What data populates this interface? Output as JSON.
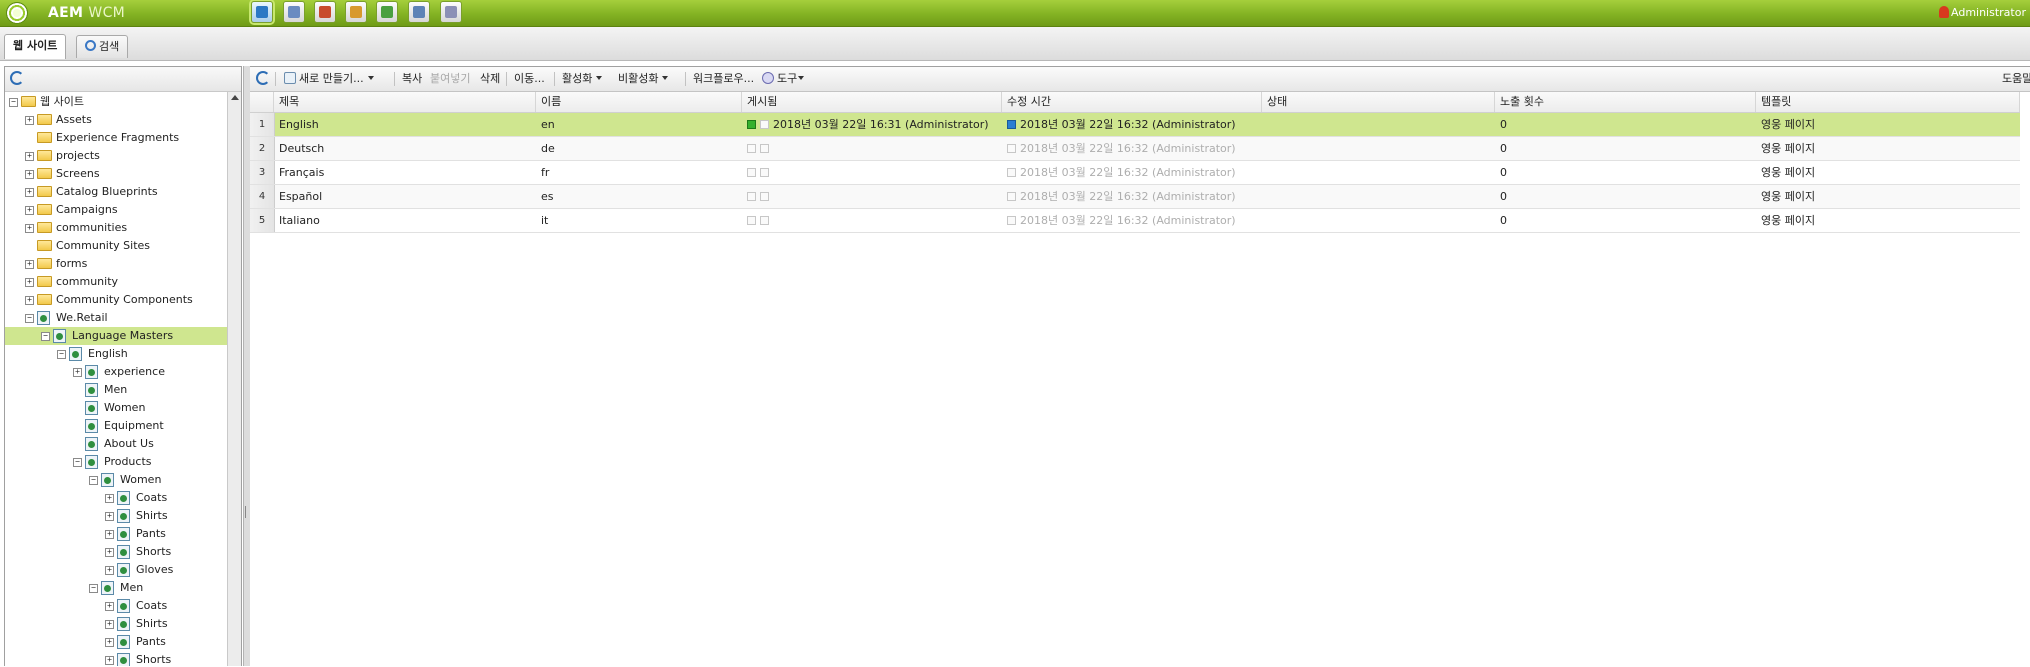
{
  "topbar": {
    "app_name": "AEM",
    "app_name_sub": "WCM",
    "user": "Administrator",
    "icons": [
      {
        "name": "websites-icon",
        "color": "#2b78c4",
        "active": true
      },
      {
        "name": "digital-assets-icon",
        "color": "#6b8cc1"
      },
      {
        "name": "tools-icon",
        "color": "#c84b2c"
      },
      {
        "name": "inbox-icon",
        "color": "#d8992e"
      },
      {
        "name": "users-icon",
        "color": "#4aa040"
      },
      {
        "name": "tagging-icon",
        "color": "#5d83b6"
      },
      {
        "name": "workflow-icon",
        "color": "#8b8fb6"
      }
    ]
  },
  "tabs": [
    {
      "label": "웹 사이트"
    },
    {
      "label": "검색"
    }
  ],
  "tree": {
    "items": [
      {
        "label": "웹 사이트",
        "level": 0,
        "expand": "-",
        "icon": "folder"
      },
      {
        "label": "Assets",
        "level": 1,
        "expand": "+",
        "icon": "folder"
      },
      {
        "label": "Experience Fragments",
        "level": 1,
        "expand": "",
        "icon": "folder"
      },
      {
        "label": "projects",
        "level": 1,
        "expand": "+",
        "icon": "folder"
      },
      {
        "label": "Screens",
        "level": 1,
        "expand": "+",
        "icon": "folder"
      },
      {
        "label": "Catalog Blueprints",
        "level": 1,
        "expand": "+",
        "icon": "folder"
      },
      {
        "label": "Campaigns",
        "level": 1,
        "expand": "+",
        "icon": "folder"
      },
      {
        "label": "communities",
        "level": 1,
        "expand": "+",
        "icon": "folder"
      },
      {
        "label": "Community Sites",
        "level": 1,
        "expand": "",
        "icon": "folder"
      },
      {
        "label": "forms",
        "level": 1,
        "expand": "+",
        "icon": "folder"
      },
      {
        "label": "community",
        "level": 1,
        "expand": "+",
        "icon": "folder"
      },
      {
        "label": "Community Components",
        "level": 1,
        "expand": "+",
        "icon": "folder"
      },
      {
        "label": "We.Retail",
        "level": 1,
        "expand": "-",
        "icon": "page"
      },
      {
        "label": "Language Masters",
        "level": 2,
        "expand": "-",
        "icon": "page",
        "selected": true
      },
      {
        "label": "English",
        "level": 3,
        "expand": "-",
        "icon": "page"
      },
      {
        "label": "experience",
        "level": 4,
        "expand": "+",
        "icon": "page"
      },
      {
        "label": "Men",
        "level": 4,
        "expand": "",
        "icon": "page"
      },
      {
        "label": "Women",
        "level": 4,
        "expand": "",
        "icon": "page"
      },
      {
        "label": "Equipment",
        "level": 4,
        "expand": "",
        "icon": "page"
      },
      {
        "label": "About Us",
        "level": 4,
        "expand": "",
        "icon": "page"
      },
      {
        "label": "Products",
        "level": 4,
        "expand": "-",
        "icon": "page"
      },
      {
        "label": "Women",
        "level": 5,
        "expand": "-",
        "icon": "page"
      },
      {
        "label": "Coats",
        "level": 6,
        "expand": "+",
        "icon": "page"
      },
      {
        "label": "Shirts",
        "level": 6,
        "expand": "+",
        "icon": "page"
      },
      {
        "label": "Pants",
        "level": 6,
        "expand": "+",
        "icon": "page"
      },
      {
        "label": "Shorts",
        "level": 6,
        "expand": "+",
        "icon": "page"
      },
      {
        "label": "Gloves",
        "level": 6,
        "expand": "+",
        "icon": "page"
      },
      {
        "label": "Men",
        "level": 5,
        "expand": "-",
        "icon": "page"
      },
      {
        "label": "Coats",
        "level": 6,
        "expand": "+",
        "icon": "page"
      },
      {
        "label": "Shirts",
        "level": 6,
        "expand": "+",
        "icon": "page"
      },
      {
        "label": "Pants",
        "level": 6,
        "expand": "+",
        "icon": "page"
      },
      {
        "label": "Shorts",
        "level": 6,
        "expand": "+",
        "icon": "page"
      }
    ]
  },
  "toolbar": {
    "new": "새로 만들기...",
    "copy": "복사",
    "paste": "붙여넣기",
    "delete": "삭제",
    "move": "이동...",
    "activate": "활성화",
    "deactivate": "비활성화",
    "workflow": "워크플로우...",
    "tools": "도구",
    "help": "도움말"
  },
  "grid": {
    "columns": [
      "제목",
      "이름",
      "게시됨",
      "수정 시간",
      "상태",
      "노출 횟수",
      "템플릿"
    ],
    "rows": [
      {
        "num": "1",
        "title": "English",
        "name": "en",
        "published": "2018년 03월 22일 16:31 (Administrator)",
        "modified": "2018년 03월 22일 16:32 (Administrator)",
        "status": "",
        "impressions": "0",
        "template": "영웅 페이지"
      },
      {
        "num": "2",
        "title": "Deutsch",
        "name": "de",
        "published": "",
        "modified": "2018년 03월 22일 16:32 (Administrator)",
        "status": "",
        "impressions": "0",
        "template": "영웅 페이지"
      },
      {
        "num": "3",
        "title": "Français",
        "name": "fr",
        "published": "",
        "modified": "2018년 03월 22일 16:32 (Administrator)",
        "status": "",
        "impressions": "0",
        "template": "영웅 페이지"
      },
      {
        "num": "4",
        "title": "Español",
        "name": "es",
        "published": "",
        "modified": "2018년 03월 22일 16:32 (Administrator)",
        "status": "",
        "impressions": "0",
        "template": "영웅 페이지"
      },
      {
        "num": "5",
        "title": "Italiano",
        "name": "it",
        "published": "",
        "modified": "2018년 03월 22일 16:32 (Administrator)",
        "status": "",
        "impressions": "0",
        "template": "영웅 페이지"
      }
    ],
    "selected_row": 0
  }
}
